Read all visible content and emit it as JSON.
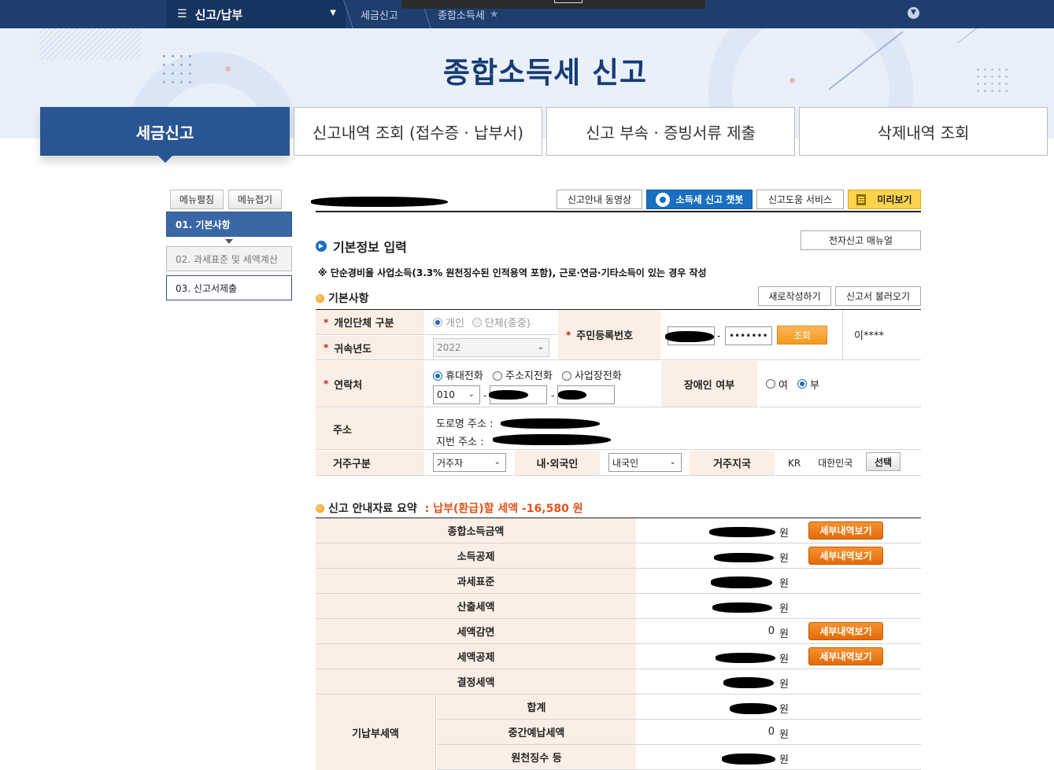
{
  "nav": {
    "menu_label": "신고/납부",
    "crumb1": "세금신고",
    "crumb2": "종합소득세"
  },
  "banner": {
    "title": "종합소득세 신고"
  },
  "tabs": [
    {
      "label": "세금신고"
    },
    {
      "label": "신고내역 조회 (접수증 · 납부서)"
    },
    {
      "label": "신고 부속 · 증빙서류 제출"
    },
    {
      "label": "삭제내역 조회"
    }
  ],
  "sidebar": {
    "expand_label": "메뉴펼침",
    "collapse_label": "메뉴접기",
    "items": [
      {
        "label": "01. 기본사항"
      },
      {
        "label": "02. 과세표준 및 세액계산"
      },
      {
        "label": "03. 신고서제출"
      }
    ]
  },
  "toolbar": {
    "video_label": "신고안내 동영상",
    "chatbot_label": "소득세 신고 챗봇",
    "help_label": "신고도움 서비스",
    "preview_label": "미리보기",
    "manual_label": "전자신고 매뉴얼",
    "new_label": "새로작성하기",
    "load_label": "신고서 불러오기"
  },
  "section": {
    "title": "기본정보 입력",
    "note": "※ 단순경비율 사업소득(3.3% 원천징수된 인적용역 포함), 근로·연금·기타소득이 있는 경우 작성",
    "basic_title": "기본사항"
  },
  "form": {
    "entity_label": "개인단체 구분",
    "entity_opt1": "개인",
    "entity_opt2": "단체(종중)",
    "year_label": "귀속년도",
    "year_value": "2022",
    "rrn_label": "주민등록번호",
    "rrn_mask": "•••••••",
    "lookup_label": "조회",
    "name_mask": "이****",
    "contact_label": "연락처",
    "phone_opt1": "휴대전화",
    "phone_opt2": "주소지전화",
    "phone_opt3": "사업장전화",
    "phone_prefix": "010",
    "disability_label": "장애인 여부",
    "dis_opt_yes": "여",
    "dis_opt_no": "부",
    "address_label": "주소",
    "road_label": "도로명 주소 :",
    "lot_label": "지번 주소 :",
    "residence_label": "거주구분",
    "residence_value": "거주자",
    "nationality_label": "내·외국인",
    "nationality_value": "내국인",
    "country_label": "거주지국",
    "country_code": "KR",
    "country_name": "대한민국",
    "select_label": "선택"
  },
  "summary": {
    "title": "신고 안내자료 요약",
    "payable": ": 납부(환급)할 세액 -16,580 원",
    "won": "원",
    "detail_label": "세부내역보기",
    "rows": [
      {
        "label": "종합소득금액",
        "value": ""
      },
      {
        "label": "소득공제",
        "value": ""
      },
      {
        "label": "과세표준",
        "value": ""
      },
      {
        "label": "산출세액",
        "value": ""
      },
      {
        "label": "세액감면",
        "value": "0"
      },
      {
        "label": "세액공제",
        "value": ""
      },
      {
        "label": "결정세액",
        "value": ""
      }
    ],
    "prepaid_label": "기납부세액",
    "prepaid_rows": [
      {
        "label": "합계",
        "value": ""
      },
      {
        "label": "중간예납세액",
        "value": "0"
      },
      {
        "label": "원천징수 등",
        "value": ""
      }
    ]
  }
}
